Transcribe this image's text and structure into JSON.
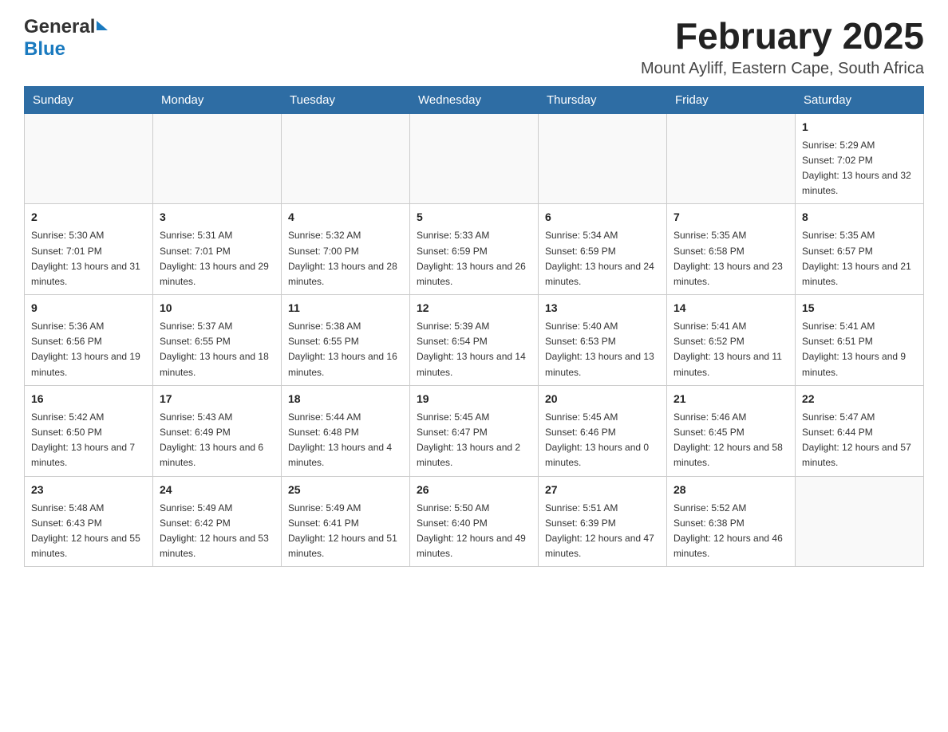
{
  "header": {
    "logo_general": "General",
    "logo_blue": "Blue",
    "month_title": "February 2025",
    "location": "Mount Ayliff, Eastern Cape, South Africa"
  },
  "weekdays": [
    "Sunday",
    "Monday",
    "Tuesday",
    "Wednesday",
    "Thursday",
    "Friday",
    "Saturday"
  ],
  "weeks": [
    [
      {
        "day": "",
        "sunrise": "",
        "sunset": "",
        "daylight": ""
      },
      {
        "day": "",
        "sunrise": "",
        "sunset": "",
        "daylight": ""
      },
      {
        "day": "",
        "sunrise": "",
        "sunset": "",
        "daylight": ""
      },
      {
        "day": "",
        "sunrise": "",
        "sunset": "",
        "daylight": ""
      },
      {
        "day": "",
        "sunrise": "",
        "sunset": "",
        "daylight": ""
      },
      {
        "day": "",
        "sunrise": "",
        "sunset": "",
        "daylight": ""
      },
      {
        "day": "1",
        "sunrise": "Sunrise: 5:29 AM",
        "sunset": "Sunset: 7:02 PM",
        "daylight": "Daylight: 13 hours and 32 minutes."
      }
    ],
    [
      {
        "day": "2",
        "sunrise": "Sunrise: 5:30 AM",
        "sunset": "Sunset: 7:01 PM",
        "daylight": "Daylight: 13 hours and 31 minutes."
      },
      {
        "day": "3",
        "sunrise": "Sunrise: 5:31 AM",
        "sunset": "Sunset: 7:01 PM",
        "daylight": "Daylight: 13 hours and 29 minutes."
      },
      {
        "day": "4",
        "sunrise": "Sunrise: 5:32 AM",
        "sunset": "Sunset: 7:00 PM",
        "daylight": "Daylight: 13 hours and 28 minutes."
      },
      {
        "day": "5",
        "sunrise": "Sunrise: 5:33 AM",
        "sunset": "Sunset: 6:59 PM",
        "daylight": "Daylight: 13 hours and 26 minutes."
      },
      {
        "day": "6",
        "sunrise": "Sunrise: 5:34 AM",
        "sunset": "Sunset: 6:59 PM",
        "daylight": "Daylight: 13 hours and 24 minutes."
      },
      {
        "day": "7",
        "sunrise": "Sunrise: 5:35 AM",
        "sunset": "Sunset: 6:58 PM",
        "daylight": "Daylight: 13 hours and 23 minutes."
      },
      {
        "day": "8",
        "sunrise": "Sunrise: 5:35 AM",
        "sunset": "Sunset: 6:57 PM",
        "daylight": "Daylight: 13 hours and 21 minutes."
      }
    ],
    [
      {
        "day": "9",
        "sunrise": "Sunrise: 5:36 AM",
        "sunset": "Sunset: 6:56 PM",
        "daylight": "Daylight: 13 hours and 19 minutes."
      },
      {
        "day": "10",
        "sunrise": "Sunrise: 5:37 AM",
        "sunset": "Sunset: 6:55 PM",
        "daylight": "Daylight: 13 hours and 18 minutes."
      },
      {
        "day": "11",
        "sunrise": "Sunrise: 5:38 AM",
        "sunset": "Sunset: 6:55 PM",
        "daylight": "Daylight: 13 hours and 16 minutes."
      },
      {
        "day": "12",
        "sunrise": "Sunrise: 5:39 AM",
        "sunset": "Sunset: 6:54 PM",
        "daylight": "Daylight: 13 hours and 14 minutes."
      },
      {
        "day": "13",
        "sunrise": "Sunrise: 5:40 AM",
        "sunset": "Sunset: 6:53 PM",
        "daylight": "Daylight: 13 hours and 13 minutes."
      },
      {
        "day": "14",
        "sunrise": "Sunrise: 5:41 AM",
        "sunset": "Sunset: 6:52 PM",
        "daylight": "Daylight: 13 hours and 11 minutes."
      },
      {
        "day": "15",
        "sunrise": "Sunrise: 5:41 AM",
        "sunset": "Sunset: 6:51 PM",
        "daylight": "Daylight: 13 hours and 9 minutes."
      }
    ],
    [
      {
        "day": "16",
        "sunrise": "Sunrise: 5:42 AM",
        "sunset": "Sunset: 6:50 PM",
        "daylight": "Daylight: 13 hours and 7 minutes."
      },
      {
        "day": "17",
        "sunrise": "Sunrise: 5:43 AM",
        "sunset": "Sunset: 6:49 PM",
        "daylight": "Daylight: 13 hours and 6 minutes."
      },
      {
        "day": "18",
        "sunrise": "Sunrise: 5:44 AM",
        "sunset": "Sunset: 6:48 PM",
        "daylight": "Daylight: 13 hours and 4 minutes."
      },
      {
        "day": "19",
        "sunrise": "Sunrise: 5:45 AM",
        "sunset": "Sunset: 6:47 PM",
        "daylight": "Daylight: 13 hours and 2 minutes."
      },
      {
        "day": "20",
        "sunrise": "Sunrise: 5:45 AM",
        "sunset": "Sunset: 6:46 PM",
        "daylight": "Daylight: 13 hours and 0 minutes."
      },
      {
        "day": "21",
        "sunrise": "Sunrise: 5:46 AM",
        "sunset": "Sunset: 6:45 PM",
        "daylight": "Daylight: 12 hours and 58 minutes."
      },
      {
        "day": "22",
        "sunrise": "Sunrise: 5:47 AM",
        "sunset": "Sunset: 6:44 PM",
        "daylight": "Daylight: 12 hours and 57 minutes."
      }
    ],
    [
      {
        "day": "23",
        "sunrise": "Sunrise: 5:48 AM",
        "sunset": "Sunset: 6:43 PM",
        "daylight": "Daylight: 12 hours and 55 minutes."
      },
      {
        "day": "24",
        "sunrise": "Sunrise: 5:49 AM",
        "sunset": "Sunset: 6:42 PM",
        "daylight": "Daylight: 12 hours and 53 minutes."
      },
      {
        "day": "25",
        "sunrise": "Sunrise: 5:49 AM",
        "sunset": "Sunset: 6:41 PM",
        "daylight": "Daylight: 12 hours and 51 minutes."
      },
      {
        "day": "26",
        "sunrise": "Sunrise: 5:50 AM",
        "sunset": "Sunset: 6:40 PM",
        "daylight": "Daylight: 12 hours and 49 minutes."
      },
      {
        "day": "27",
        "sunrise": "Sunrise: 5:51 AM",
        "sunset": "Sunset: 6:39 PM",
        "daylight": "Daylight: 12 hours and 47 minutes."
      },
      {
        "day": "28",
        "sunrise": "Sunrise: 5:52 AM",
        "sunset": "Sunset: 6:38 PM",
        "daylight": "Daylight: 12 hours and 46 minutes."
      },
      {
        "day": "",
        "sunrise": "",
        "sunset": "",
        "daylight": ""
      }
    ]
  ]
}
